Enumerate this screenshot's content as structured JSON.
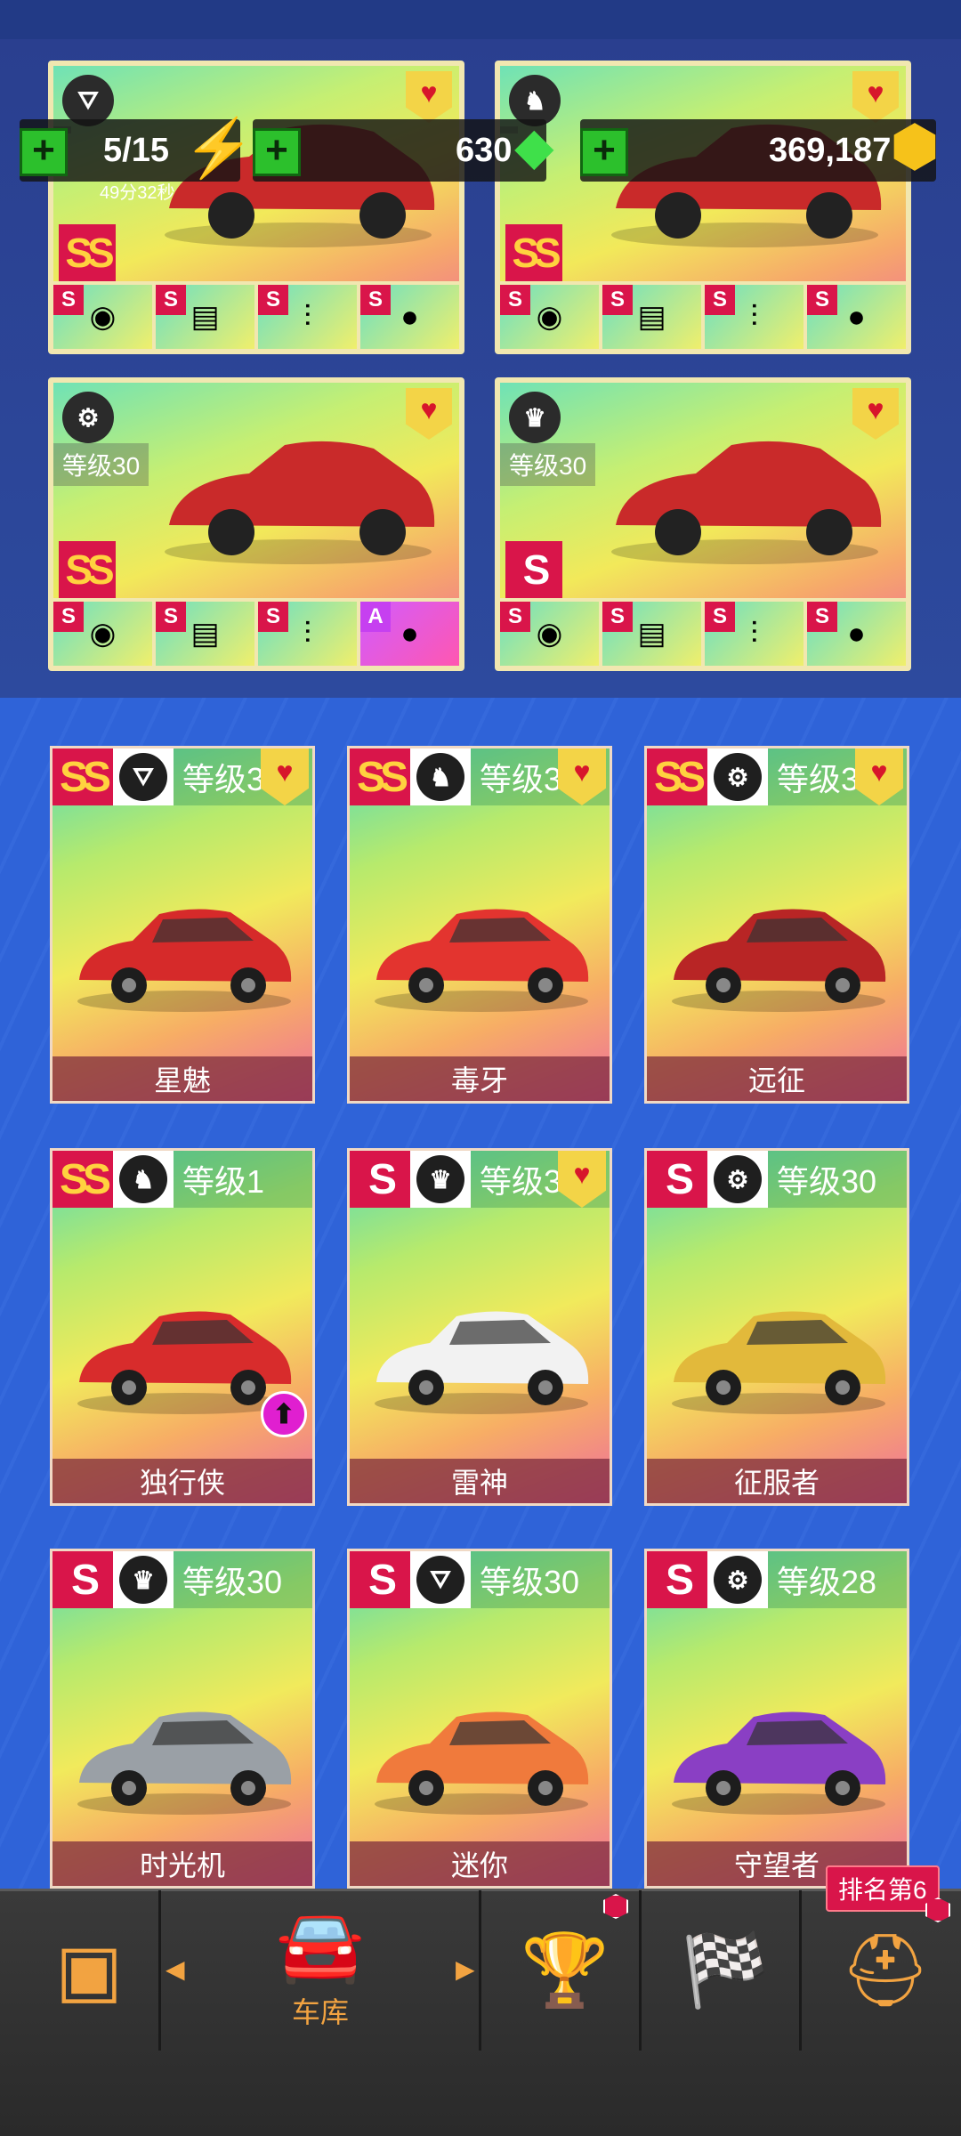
{
  "resources": {
    "fuel": {
      "value": "5/15",
      "timer": "49分32秒",
      "icon": "lightning-icon"
    },
    "gems": {
      "value": "630",
      "icon": "green-gem-icon"
    },
    "coins": {
      "value": "369,187",
      "icon": "gold-coin-icon"
    }
  },
  "featured": [
    {
      "class_icon": "road-icon",
      "level": "",
      "rank": "SS",
      "parts": [
        "S",
        "S",
        "S",
        "S"
      ],
      "favorite": true
    },
    {
      "class_icon": "horse-icon",
      "level": "",
      "rank": "SS",
      "parts": [
        "S",
        "S",
        "S",
        "S"
      ],
      "favorite": true
    },
    {
      "class_icon": "wheel-icon",
      "level": "等级30",
      "rank": "SS",
      "parts": [
        "S",
        "S",
        "S",
        "A"
      ],
      "favorite": true
    },
    {
      "class_icon": "crown-icon",
      "level": "等级30",
      "rank": "S",
      "parts": [
        "S",
        "S",
        "S",
        "S"
      ],
      "favorite": true
    }
  ],
  "part_icons": [
    "turbo-icon",
    "ecu-icon",
    "suspension-icon",
    "tire-icon"
  ],
  "garage": [
    {
      "rank": "SS",
      "class_icon": "road-icon",
      "level": "等级3",
      "name": "星魅",
      "favorite": true,
      "color": "#d62a2a"
    },
    {
      "rank": "SS",
      "class_icon": "horse-icon",
      "level": "等级3",
      "name": "毒牙",
      "favorite": true,
      "color": "#e3342f"
    },
    {
      "rank": "SS",
      "class_icon": "wheel-icon",
      "level": "等级3",
      "name": "远征",
      "favorite": true,
      "color": "#b82525"
    },
    {
      "rank": "SS",
      "class_icon": "horse-icon",
      "level": "等级1",
      "name": "独行侠",
      "favorite": false,
      "color": "#d82c2c",
      "upgrade": true
    },
    {
      "rank": "S",
      "class_icon": "crown-icon",
      "level": "等级3",
      "name": "雷神",
      "favorite": true,
      "color": "#f2f2f2"
    },
    {
      "rank": "S",
      "class_icon": "wheel-icon",
      "level": "等级30",
      "name": "征服者",
      "favorite": false,
      "color": "#e2b93b"
    },
    {
      "rank": "S",
      "class_icon": "crown-icon",
      "level": "等级30",
      "name": "时光机",
      "favorite": false,
      "color": "#9aa0a6"
    },
    {
      "rank": "S",
      "class_icon": "road-icon",
      "level": "等级30",
      "name": "迷你",
      "favorite": false,
      "color": "#f07a3c"
    },
    {
      "rank": "S",
      "class_icon": "wheel-icon",
      "level": "等级28",
      "name": "守望者",
      "favorite": false,
      "color": "#8a3fc4"
    }
  ],
  "nav": {
    "garage_label": "车库",
    "ranking_tag": "排名第6"
  },
  "colors": {
    "accent": "#f2a341",
    "rank_red": "#d9154a",
    "heart_badge": "#f3d447"
  }
}
